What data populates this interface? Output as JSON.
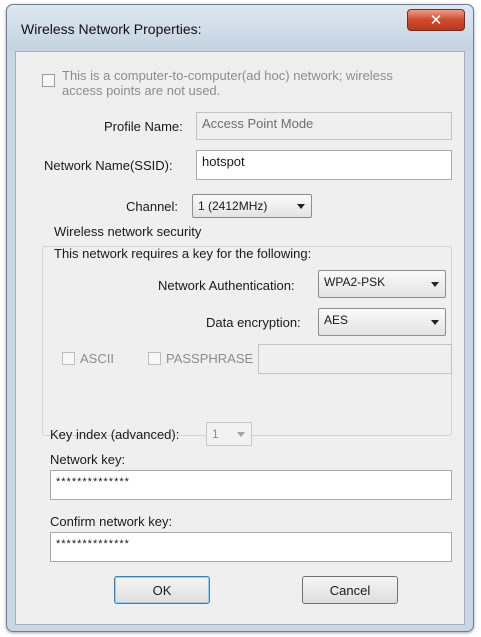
{
  "window": {
    "title": "Wireless Network Properties:",
    "close_glyph": "✕"
  },
  "adhoc": {
    "label_line1": "This is a computer-to-computer(ad hoc) network; wireless",
    "label_line2": "access points are not used.",
    "checked": false
  },
  "profile": {
    "label": "Profile Name:",
    "value": "Access Point Mode"
  },
  "ssid": {
    "label": "Network Name(SSID):",
    "value": "hotspot"
  },
  "channel": {
    "label": "Channel:",
    "value": "1  (2412MHz)"
  },
  "security": {
    "group_label": "Wireless network security",
    "intro": "This network requires a key for the following:",
    "auth_label": "Network Authentication:",
    "auth_value": "WPA2-PSK",
    "enc_label": "Data encryption:",
    "enc_value": "AES",
    "ascii_label": "ASCII",
    "passphrase_label": "PASSPHRASE",
    "passphrase_value": ""
  },
  "key_index": {
    "label": "Key index (advanced):",
    "value": "1"
  },
  "network_key": {
    "label": "Network key:",
    "value": "**************"
  },
  "confirm_key": {
    "label": "Confirm network key:",
    "value": "**************"
  },
  "buttons": {
    "ok": "OK",
    "cancel": "Cancel"
  }
}
